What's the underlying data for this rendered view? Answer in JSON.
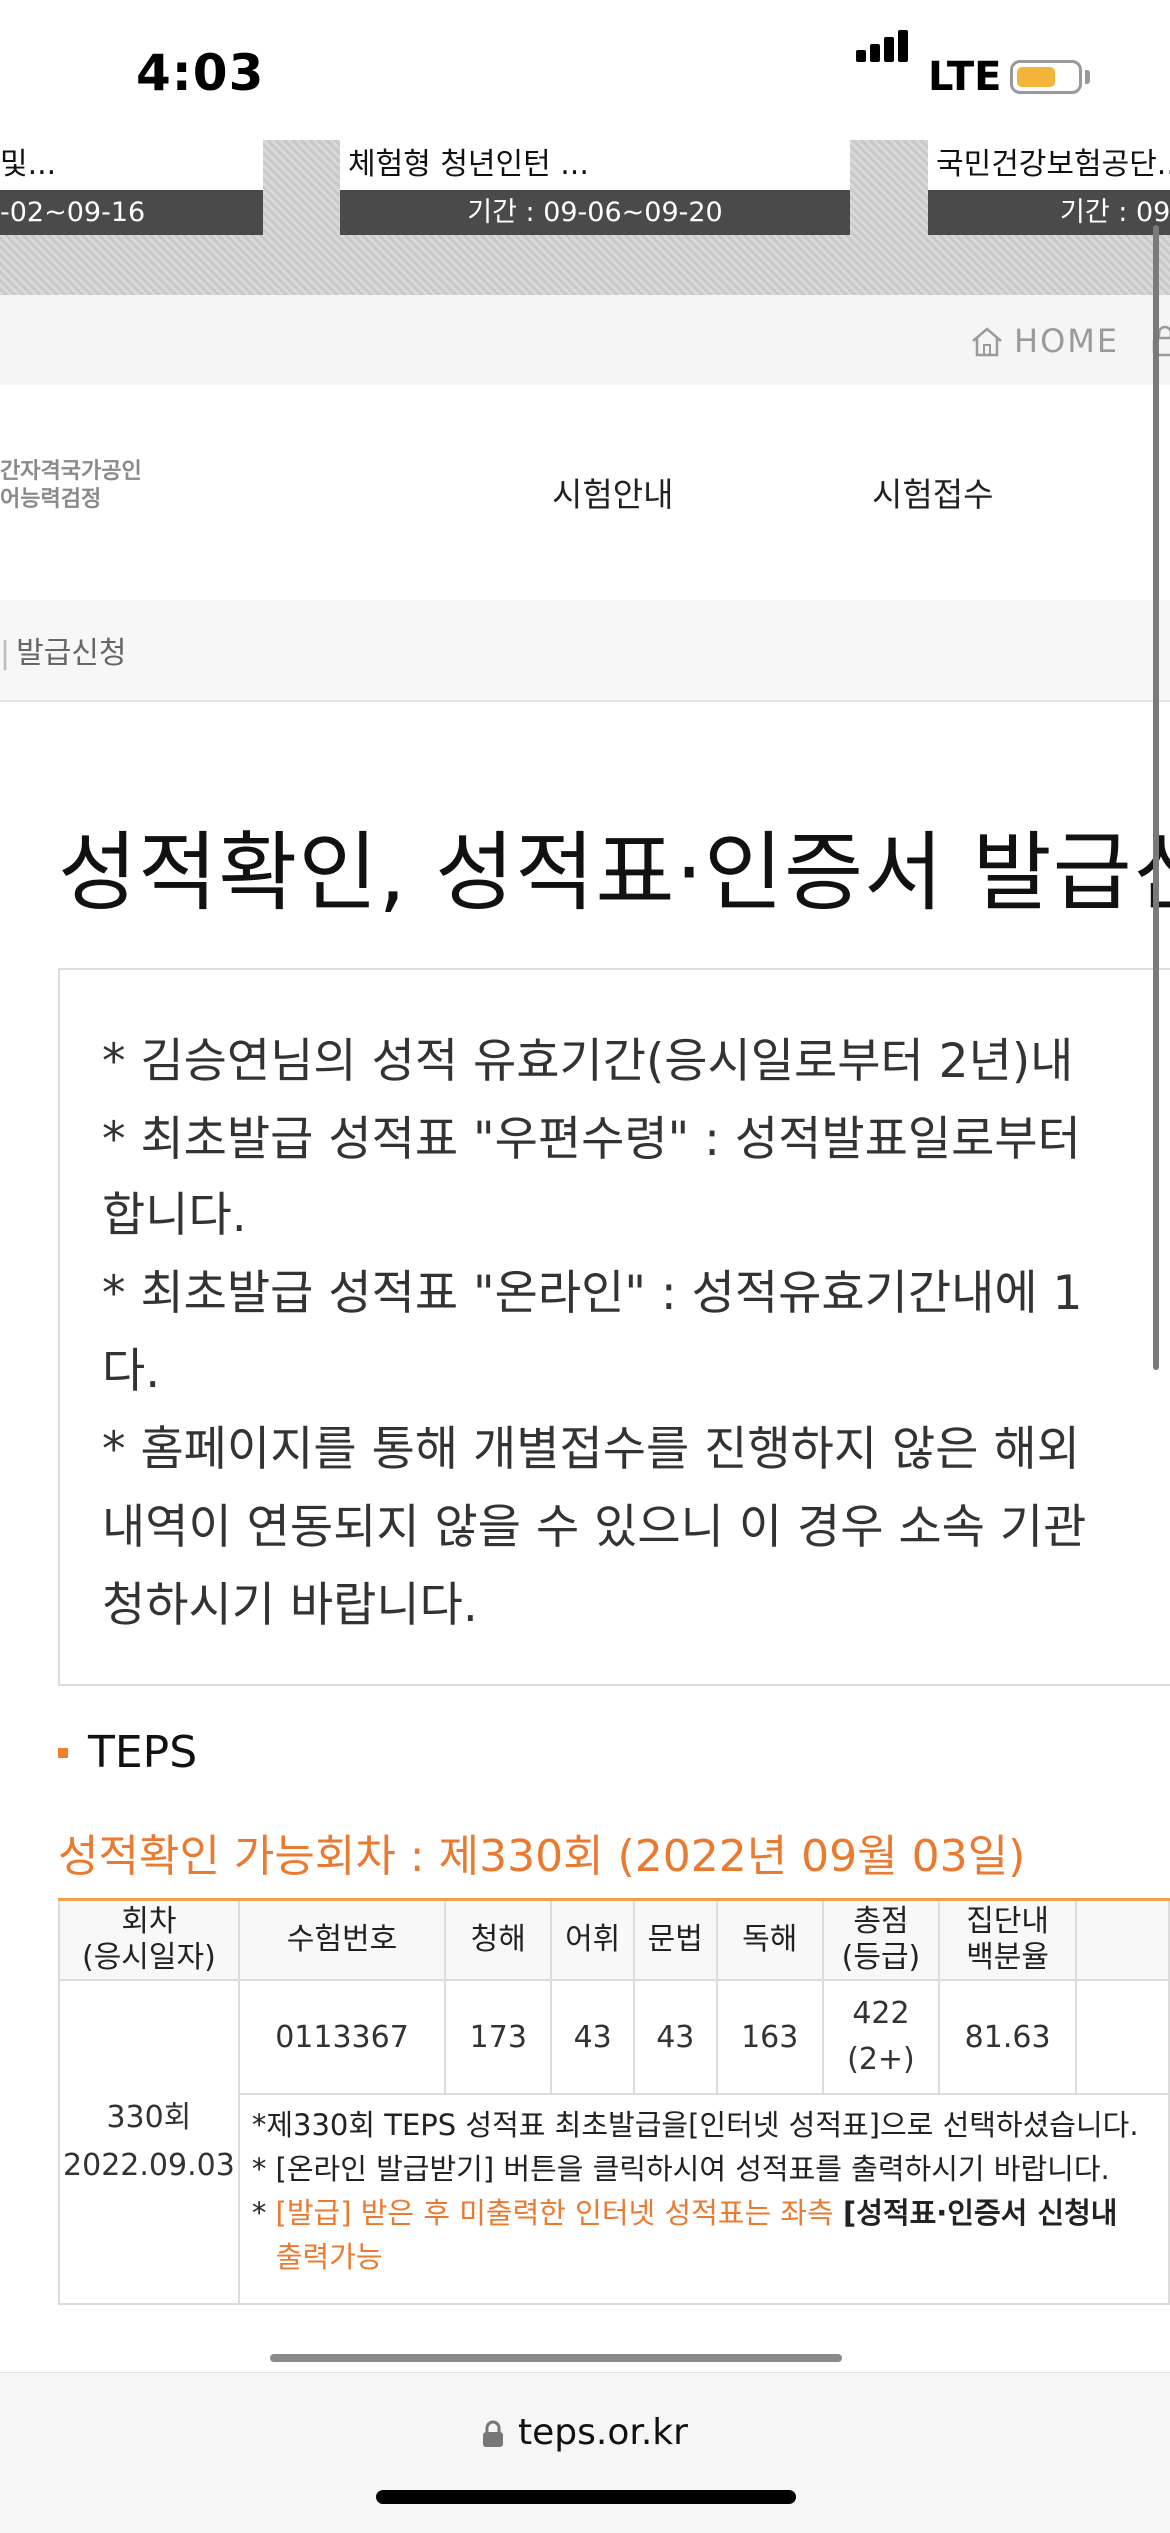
{
  "status_bar": {
    "time": "4:03",
    "network": "LTE",
    "battery_level": 0.65
  },
  "banners": [
    {
      "title": "및...",
      "period": "-02~09-16"
    },
    {
      "title": "체험형 청년인턴 ...",
      "period": "기간 : 09-06~09-20"
    },
    {
      "title": "국민건강보험공단...",
      "period": "기간 : 09"
    }
  ],
  "util": {
    "home_label": "HOME"
  },
  "logo": {
    "line1": "간자격국가공인",
    "line2": "어능력검정"
  },
  "gnb": {
    "items": [
      "시험안내",
      "시험접수"
    ]
  },
  "breadcrumb": {
    "current": "발급신청"
  },
  "page_title": "성적확인, 성적표·인증서 발급신",
  "notice": {
    "lines": [
      "* 김승연님의 성적 유효기간(응시일로부터 2년)내",
      "* 최초발급 성적표 \"우편수령\" : 성적발표일로부터",
      "합니다.",
      "* 최초발급 성적표 \"온라인\" : 성적유효기간내에 1",
      "다.",
      "* 홈페이지를 통해 개별접수를 진행하지 않은 해외",
      "내역이 연동되지 않을 수 있으니 이 경우 소속 기관",
      "청하시기 바랍니다."
    ]
  },
  "teps": {
    "label": "TEPS",
    "session_line": "성적확인 가능회차 : 제330회 (2022년 09월 03일)",
    "table": {
      "headers": [
        {
          "line1": "회차",
          "line2": "(응시일자)"
        },
        {
          "line1": "수험번호",
          "line2": ""
        },
        {
          "line1": "청해",
          "line2": ""
        },
        {
          "line1": "어휘",
          "line2": ""
        },
        {
          "line1": "문법",
          "line2": ""
        },
        {
          "line1": "독해",
          "line2": ""
        },
        {
          "line1": "총점",
          "line2": "(등급)"
        },
        {
          "line1": "집단내",
          "line2": "백분율"
        }
      ],
      "row": {
        "session": "330회",
        "date": "2022.09.03",
        "exam_no": "0113367",
        "listening": "173",
        "vocab": "43",
        "grammar": "43",
        "reading": "163",
        "total": "422",
        "grade": "(2+)",
        "percentile": "81.63"
      },
      "notes": {
        "n1": "*제330회 TEPS 성적표 최초발급을[인터넷 성적표]으로 선택하셨습니다.",
        "n2": "* [온라인 발급받기] 버튼을 클릭하시여 성적표를 출력하시기 바랍니다.",
        "n3_prefix": "* ",
        "n3_orange": "[발급] 받은 후 미출력한 인터넷 성적표는 좌측 ",
        "n3_bold": "[성적표·인증서 신청내",
        "n3_cont": "출력가능"
      }
    }
  },
  "url_bar": {
    "domain": "teps.or.kr"
  },
  "colors": {
    "accent": "#ea7a30",
    "table_top": "#f0a04b",
    "battery": "#f2b53a"
  }
}
